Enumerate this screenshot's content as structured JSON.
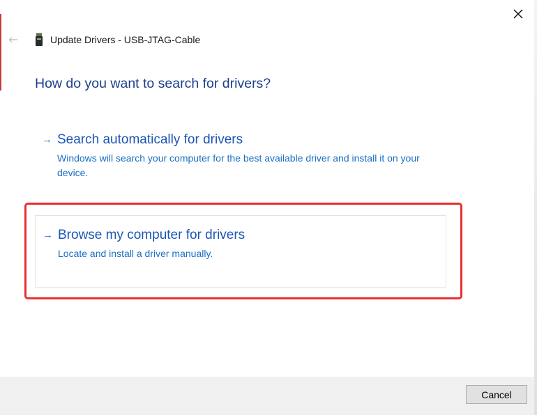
{
  "window": {
    "title": "Update Drivers - USB-JTAG-Cable"
  },
  "icons": {
    "close": "close-icon",
    "back": "back-arrow-icon",
    "device": "usb-device-icon",
    "option_arrow": "right-arrow-icon"
  },
  "main": {
    "heading": "How do you want to search for drivers?",
    "options": [
      {
        "arrow": "→",
        "title": "Search automatically for drivers",
        "description": "Windows will search your computer for the best available driver and install it on your device."
      },
      {
        "arrow": "→",
        "title": "Browse my computer for drivers",
        "description": "Locate and install a driver manually."
      }
    ]
  },
  "footer": {
    "cancel_label": "Cancel"
  },
  "colors": {
    "heading": "#1c3f8c",
    "link": "#1c55b4",
    "highlight": "#e8302e"
  }
}
